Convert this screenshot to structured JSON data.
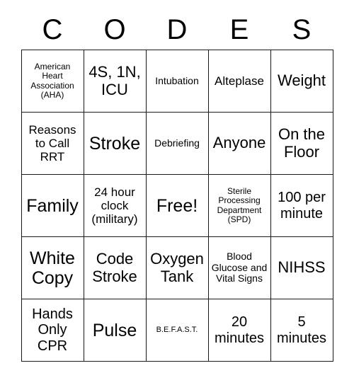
{
  "card": {
    "title_letters": [
      "C",
      "O",
      "D",
      "E",
      "S"
    ],
    "rows": [
      [
        {
          "text": "American Heart Association (AHA)",
          "size": "xs"
        },
        {
          "text": "4S, 1N, ICU",
          "size": "xl"
        },
        {
          "text": "Intubation",
          "size": "sm"
        },
        {
          "text": "Alteplase",
          "size": "md"
        },
        {
          "text": "Weight",
          "size": "xl"
        }
      ],
      [
        {
          "text": "Reasons to Call RRT",
          "size": "md"
        },
        {
          "text": "Stroke",
          "size": "xxl"
        },
        {
          "text": "Debriefing",
          "size": "sm"
        },
        {
          "text": "Anyone",
          "size": "xl"
        },
        {
          "text": "On the Floor",
          "size": "xl"
        }
      ],
      [
        {
          "text": "Family",
          "size": "xxl"
        },
        {
          "text": "24 hour clock (military)",
          "size": "md"
        },
        {
          "text": "Free!",
          "size": "xxl"
        },
        {
          "text": "Sterile Processing Department (SPD)",
          "size": "xs"
        },
        {
          "text": "100 per minute",
          "size": "lg"
        }
      ],
      [
        {
          "text": "White Copy",
          "size": "xxl"
        },
        {
          "text": "Code Stroke",
          "size": "xl"
        },
        {
          "text": "Oxygen Tank",
          "size": "xl"
        },
        {
          "text": "Blood Glucose and Vital Signs",
          "size": "sm"
        },
        {
          "text": "NIHSS",
          "size": "xl"
        }
      ],
      [
        {
          "text": "Hands Only CPR",
          "size": "lg"
        },
        {
          "text": "Pulse",
          "size": "xxl"
        },
        {
          "text": "B.E.F.A.S.T.",
          "size": "tiny"
        },
        {
          "text": "20 minutes",
          "size": "lg"
        },
        {
          "text": "5 minutes",
          "size": "lg"
        }
      ]
    ]
  },
  "colors": {
    "border": "#1a1a1a",
    "text": "#000000",
    "background": "#ffffff"
  }
}
